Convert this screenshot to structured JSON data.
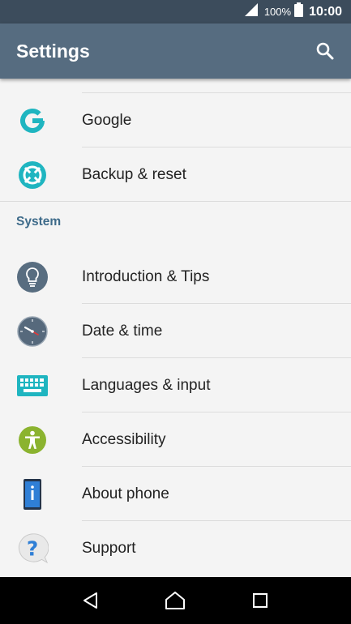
{
  "status_bar": {
    "battery_percent": "100%",
    "time": "10:00"
  },
  "app_bar": {
    "title": "Settings"
  },
  "items_top": [
    {
      "label": "Google",
      "icon": "google-icon"
    },
    {
      "label": "Backup & reset",
      "icon": "backup-reset-icon"
    }
  ],
  "section": {
    "title": "System"
  },
  "items_system": [
    {
      "label": "Introduction & Tips",
      "icon": "lightbulb-icon"
    },
    {
      "label": "Date & time",
      "icon": "clock-icon"
    },
    {
      "label": "Languages & input",
      "icon": "keyboard-icon"
    },
    {
      "label": "Accessibility",
      "icon": "accessibility-icon"
    },
    {
      "label": "About phone",
      "icon": "phone-info-icon"
    },
    {
      "label": "Support",
      "icon": "support-question-icon"
    }
  ],
  "colors": {
    "status_bar": "#3c4c5c",
    "app_bar": "#566c80",
    "section_header": "#3e6b8a",
    "background": "#f4f4f4"
  }
}
